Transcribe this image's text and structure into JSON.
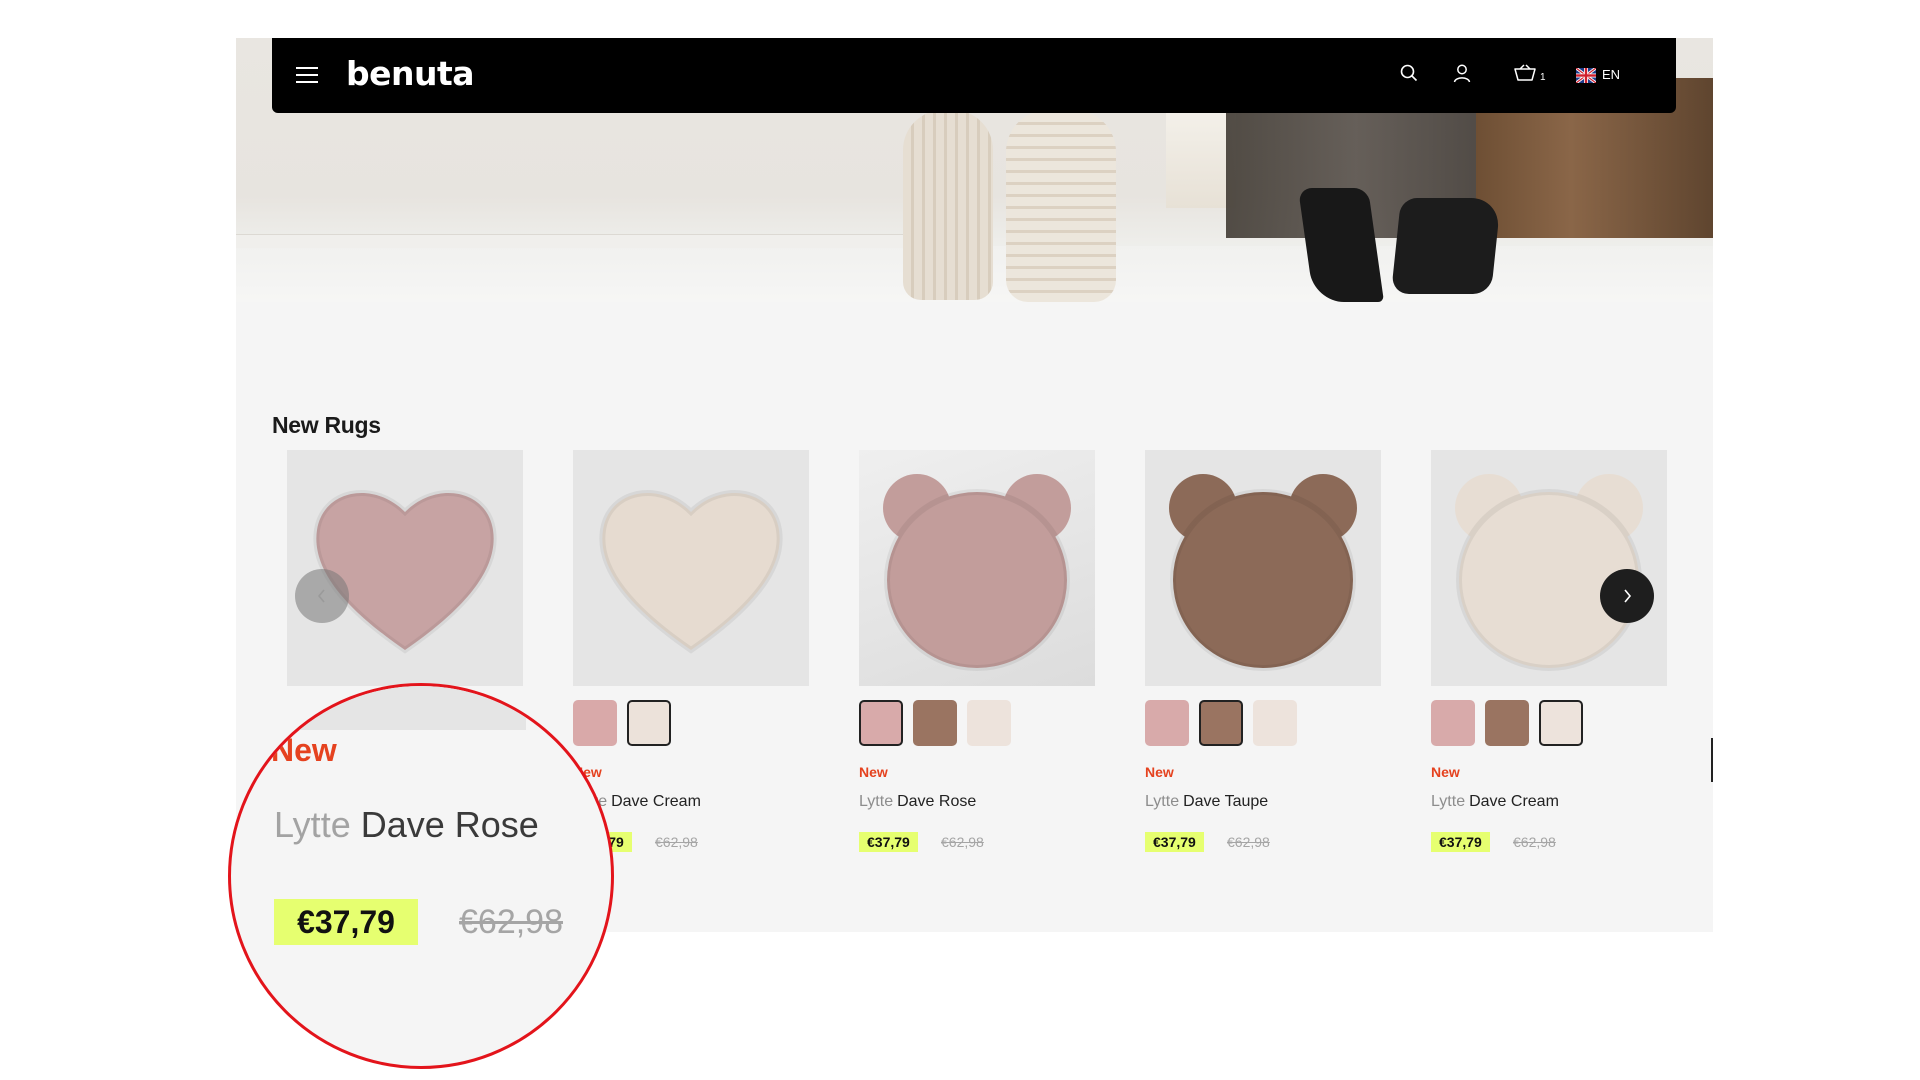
{
  "header": {
    "logo": "benuta",
    "cart_count": "1",
    "language": "EN"
  },
  "section": {
    "title": "New Rugs"
  },
  "products": [
    {
      "badge": "New",
      "brand": "Lytte",
      "name": "Dave Rose",
      "price": "€37,79",
      "old_price": "€62,98",
      "shape": "heart",
      "color": "#c7a3a3",
      "swatches": []
    },
    {
      "badge": "New",
      "brand": "Lytte",
      "name": "Dave Cream",
      "price": "€37,79",
      "old_price": "€62,98",
      "shape": "heart",
      "color": "#e6dbd0",
      "swatches": [
        {
          "color": "#d9a9a9",
          "selected": false
        },
        {
          "color": "#ece2da",
          "selected": true
        }
      ]
    },
    {
      "badge": "New",
      "brand": "Lytte",
      "name": "Dave Rose",
      "price": "€37,79",
      "old_price": "€62,98",
      "shape": "bear",
      "color": "#c29d9b",
      "swatches": [
        {
          "color": "#d8aaaa",
          "selected": true
        },
        {
          "color": "#9a7461",
          "selected": false
        },
        {
          "color": "#ede3dc",
          "selected": false
        }
      ]
    },
    {
      "badge": "New",
      "brand": "Lytte",
      "name": "Dave Taupe",
      "price": "€37,79",
      "old_price": "€62,98",
      "shape": "bear",
      "color": "#8c6a58",
      "swatches": [
        {
          "color": "#d8aaaa",
          "selected": false
        },
        {
          "color": "#9a7461",
          "selected": true
        },
        {
          "color": "#ede3dc",
          "selected": false
        }
      ]
    },
    {
      "badge": "New",
      "brand": "Lytte",
      "name": "Dave Cream",
      "price": "€37,79",
      "old_price": "€62,98",
      "shape": "bear",
      "color": "#e7ddd3",
      "swatches": [
        {
          "color": "#d8aaaa",
          "selected": false
        },
        {
          "color": "#9a7461",
          "selected": false
        },
        {
          "color": "#ede3dc",
          "selected": true
        }
      ]
    }
  ],
  "zoom": {
    "badge": "New",
    "brand": "Lytte",
    "name": "Dave Rose",
    "price": "€37,79",
    "old_price": "€62,98"
  },
  "colors": {
    "highlight": "#e6ff70",
    "accent_red": "#e5421f",
    "callout_ring": "#e3141b"
  }
}
